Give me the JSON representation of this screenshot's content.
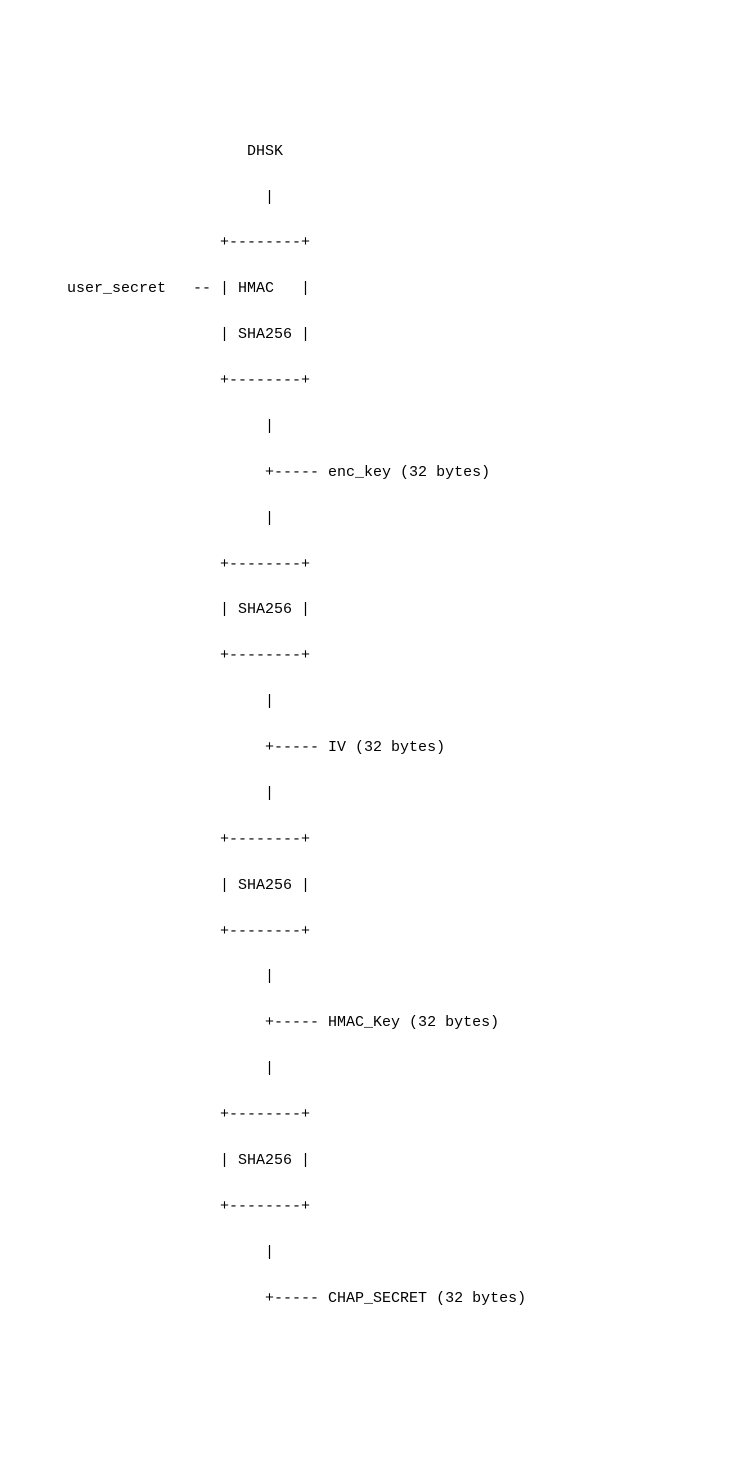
{
  "lines": {
    "l1": "                       DHSK",
    "l2": "                         |",
    "l3": "                    +--------+",
    "l4": "   user_secret   -- | HMAC   |",
    "l5": "                    | SHA256 |",
    "l6": "                    +--------+",
    "l7": "                         |",
    "l8": "                         +----- enc_key (32 bytes)",
    "l9": "                         |",
    "l10": "                    +--------+",
    "l11": "                    | SHA256 |",
    "l12": "                    +--------+",
    "l13": "                         |",
    "l14": "                         +----- IV (32 bytes)",
    "l15": "                         |",
    "l16": "                    +--------+",
    "l17": "                    | SHA256 |",
    "l18": "                    +--------+",
    "l19": "                         |",
    "l20": "                         +----- HMAC_Key (32 bytes)",
    "l21": "                         |",
    "l22": "                    +--------+",
    "l23": "                    | SHA256 |",
    "l24": "                    +--------+",
    "l25": "                         |",
    "l26": "                         +----- CHAP_SECRET (32 bytes)"
  }
}
